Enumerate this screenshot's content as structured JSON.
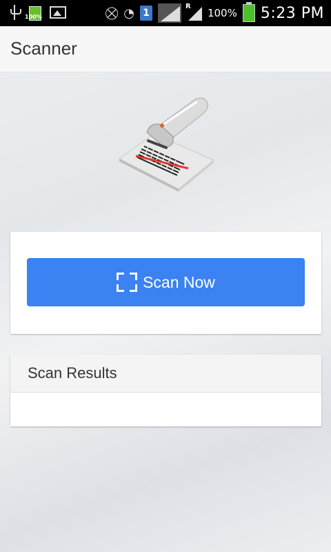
{
  "status_bar": {
    "battery_small_percent": "100%",
    "sim_slot": "1",
    "roaming": "R",
    "battery_percent": "100%",
    "time": "5:23 PM",
    "icons": [
      "usb-icon",
      "battery-icon",
      "image-icon",
      "mute-icon",
      "wifi-icon",
      "sim-icon",
      "signal-icon",
      "signal-roaming-icon",
      "battery-icon"
    ]
  },
  "app_bar": {
    "title": "Scanner"
  },
  "illustration": {
    "icon": "barcode-scanner-icon"
  },
  "scan_card": {
    "button_label": "Scan Now",
    "button_icon": "scan-frame-icon",
    "button_color": "#3b82f2"
  },
  "results_card": {
    "header_label": "Scan Results",
    "results": []
  }
}
